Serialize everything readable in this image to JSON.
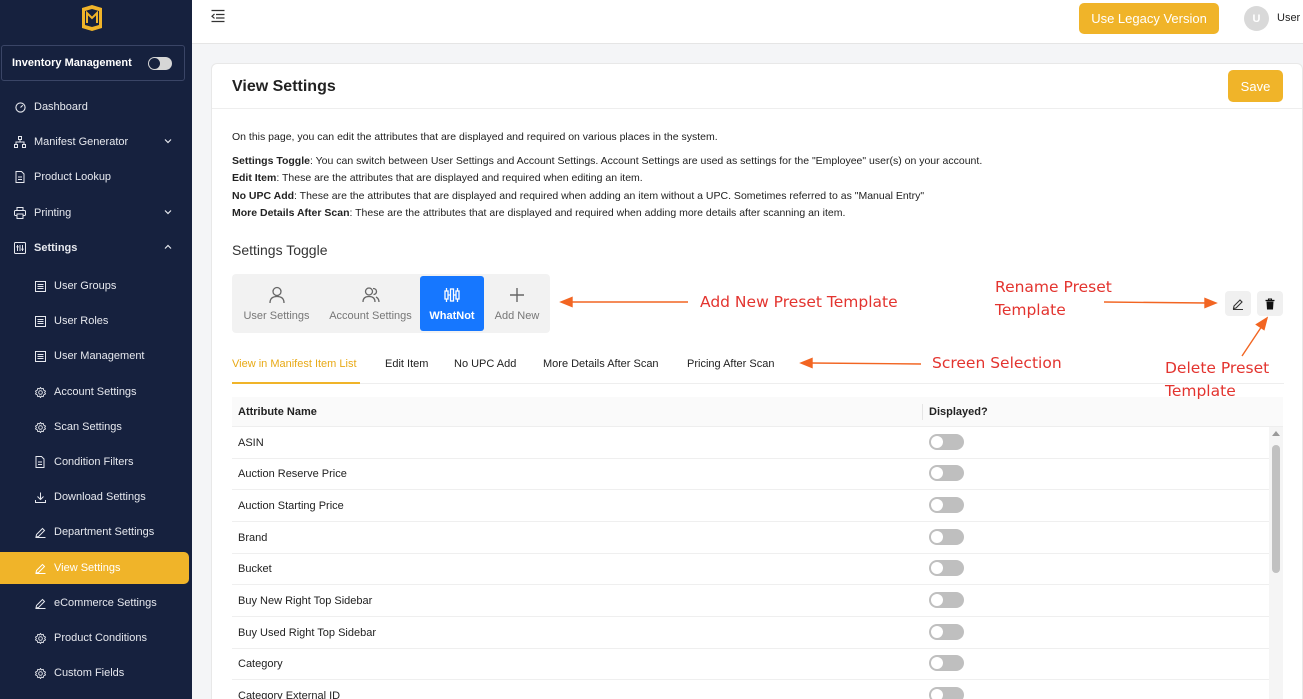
{
  "sidebar": {
    "logo": "m-cube-logo",
    "inventory": {
      "label": "Inventory Management",
      "toggle_on": false
    },
    "items": [
      {
        "label": "Dashboard",
        "icon": "dashboard-icon"
      },
      {
        "label": "Manifest Generator",
        "icon": "sitemap-icon"
      },
      {
        "label": "Product Lookup",
        "icon": "document-icon"
      },
      {
        "label": "Printing",
        "icon": "printer-icon"
      },
      {
        "label": "Settings",
        "icon": "settings-icon"
      }
    ],
    "sub_items": [
      {
        "label": "User Groups"
      },
      {
        "label": "User Roles"
      },
      {
        "label": "User Management"
      },
      {
        "label": "Account Settings"
      },
      {
        "label": "Scan Settings"
      },
      {
        "label": "Condition Filters"
      },
      {
        "label": "Download Settings"
      },
      {
        "label": "Department Settings"
      },
      {
        "label": "View Settings"
      },
      {
        "label": "eCommerce Settings"
      },
      {
        "label": "Product Conditions"
      },
      {
        "label": "Custom Fields"
      }
    ]
  },
  "topbar": {
    "legacy_label": "Use Legacy Version",
    "avatar_initial": "U",
    "user_label": "User"
  },
  "page": {
    "title": "View Settings",
    "save_label": "Save",
    "intro": "On this page, you can edit the attributes that are displayed and required on various places in the system.",
    "desc1_label": "Settings Toggle",
    "desc1_text": ": You can switch between User Settings and Account Settings. Account Settings are used as settings for the \"Employee\" user(s) on your account.",
    "desc2_label": "Edit Item",
    "desc2_text": ": These are the attributes that are displayed and required when editing an item.",
    "desc3_label": "No UPC Add",
    "desc3_text": ": These are the attributes that are displayed and required when adding an item without a UPC. Sometimes referred to as \"Manual Entry\"",
    "desc4_label": "More Details After Scan",
    "desc4_text": ": These are the attributes that are displayed and required when adding more details after scanning an item.",
    "toggle_title": "Settings Toggle"
  },
  "segments": [
    {
      "label": "User Settings",
      "icon": "user-icon"
    },
    {
      "label": "Account Settings",
      "icon": "users-icon"
    },
    {
      "label": "WhatNot",
      "icon": "whatnot-icon",
      "active": true
    },
    {
      "label": "Add New",
      "icon": "plus-icon"
    }
  ],
  "tabs": [
    {
      "label": "View in Manifest Item List",
      "active": true
    },
    {
      "label": "Edit Item"
    },
    {
      "label": "No UPC Add"
    },
    {
      "label": "More Details After Scan"
    },
    {
      "label": "Pricing After Scan"
    }
  ],
  "annotations": {
    "add_new": "Add New Preset Template",
    "rename_1": "Rename Preset",
    "rename_2": "Template",
    "screen_selection": "Screen Selection",
    "delete_1": "Delete Preset",
    "delete_2": "Template"
  },
  "table": {
    "col_name": "Attribute Name",
    "col_displayed": "Displayed?",
    "rows": [
      {
        "name": "ASIN",
        "displayed": false
      },
      {
        "name": "Auction Reserve Price",
        "displayed": false
      },
      {
        "name": "Auction Starting Price",
        "displayed": false
      },
      {
        "name": "Brand",
        "displayed": false
      },
      {
        "name": "Bucket",
        "displayed": false
      },
      {
        "name": "Buy New Right Top Sidebar",
        "displayed": false
      },
      {
        "name": "Buy Used Right Top Sidebar",
        "displayed": false
      },
      {
        "name": "Category",
        "displayed": false
      },
      {
        "name": "Category External ID",
        "displayed": false
      }
    ]
  },
  "colors": {
    "sidebar_bg": "#16213e",
    "accent": "#f0b429",
    "primary": "#1677ff",
    "annotation": "#e3342f"
  }
}
